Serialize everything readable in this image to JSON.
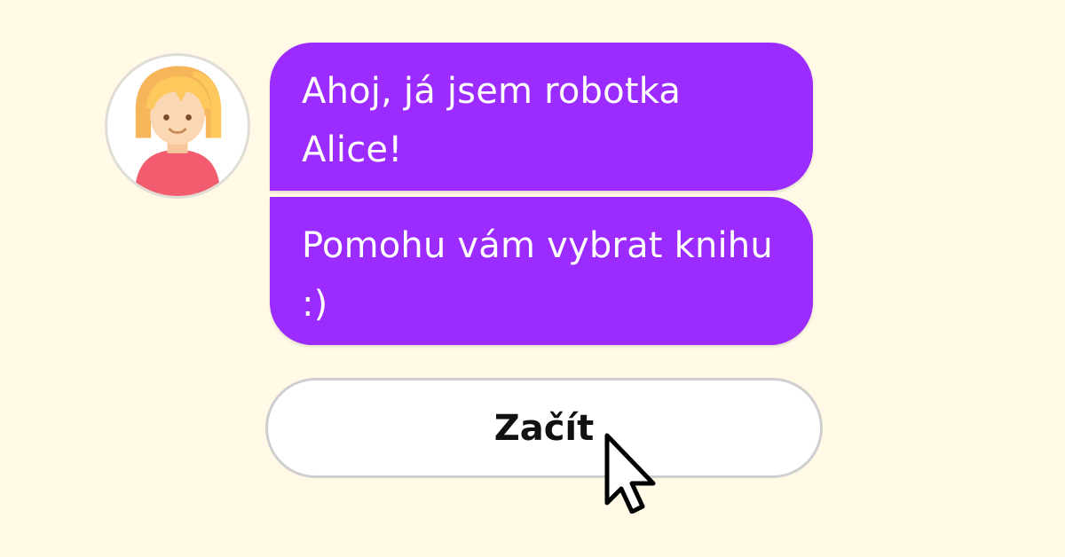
{
  "chat": {
    "messages": [
      {
        "text": "Ahoj, já jsem robotka Alice!"
      },
      {
        "text": "Pomohu vám vybrat knihu :)"
      }
    ]
  },
  "actions": {
    "start_label": "Začít"
  },
  "icons": {
    "avatar": "girl-avatar-icon",
    "cursor": "mouse-pointer-icon"
  },
  "colors": {
    "background": "#fff9e6",
    "bubble": "#9b2bff",
    "bubble_text": "#ffffff",
    "button_bg": "#ffffff",
    "button_border": "#cfcfcf"
  }
}
